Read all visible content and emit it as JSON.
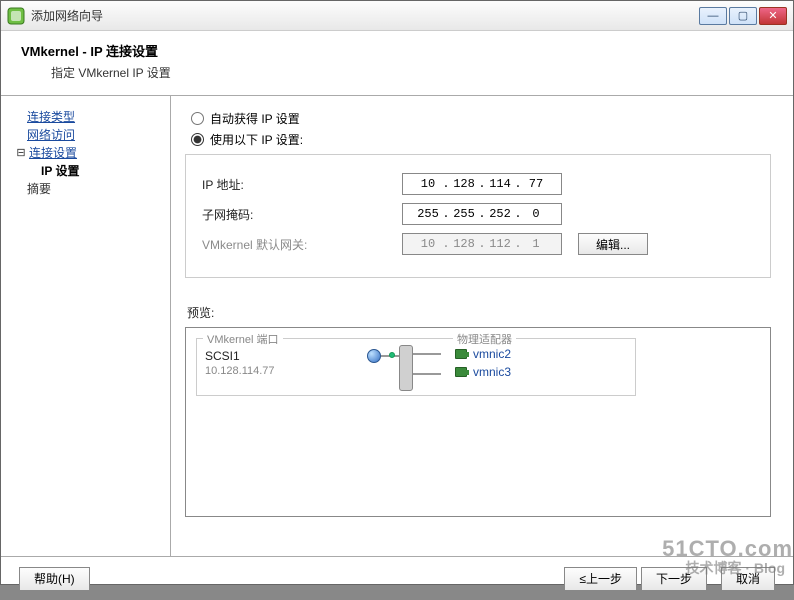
{
  "window": {
    "title": "添加网络向导",
    "header_title": "VMkernel - IP 连接设置",
    "header_subtitle": "指定 VMkernel IP 设置",
    "winbtns": {
      "min": "—",
      "max": "▢",
      "close": "✕"
    }
  },
  "sidebar": {
    "items": [
      {
        "label": "连接类型"
      },
      {
        "label": "网络访问"
      },
      {
        "label": "连接设置"
      },
      {
        "label": "IP 设置"
      },
      {
        "label": "摘要"
      }
    ]
  },
  "ip": {
    "radio_auto": "自动获得 IP 设置",
    "radio_manual": "使用以下 IP 设置:",
    "labels": {
      "address": "IP 地址:",
      "mask": "子网掩码:",
      "gateway": "VMkernel 默认网关:"
    },
    "address": {
      "o1": "10",
      "o2": "128",
      "o3": "114",
      "o4": "77"
    },
    "mask": {
      "o1": "255",
      "o2": "255",
      "o3": "252",
      "o4": "0"
    },
    "gateway": {
      "o1": "10",
      "o2": "128",
      "o3": "112",
      "o4": "1"
    },
    "edit_button": "编辑..."
  },
  "preview": {
    "label": "预览:",
    "portgroup_label": "VMkernel 端口",
    "adapter_label": "物理适配器",
    "pg_name": "SCSI1",
    "pg_ip": "10.128.114.77",
    "nics": [
      {
        "name": "vmnic2"
      },
      {
        "name": "vmnic3"
      }
    ]
  },
  "footer": {
    "help": "帮助(H)",
    "back": "≤上一步",
    "next": "下一步",
    "cancel": "取消"
  },
  "watermark": {
    "line1": "51CTO.com",
    "line2": "技术博客 · Blog"
  }
}
